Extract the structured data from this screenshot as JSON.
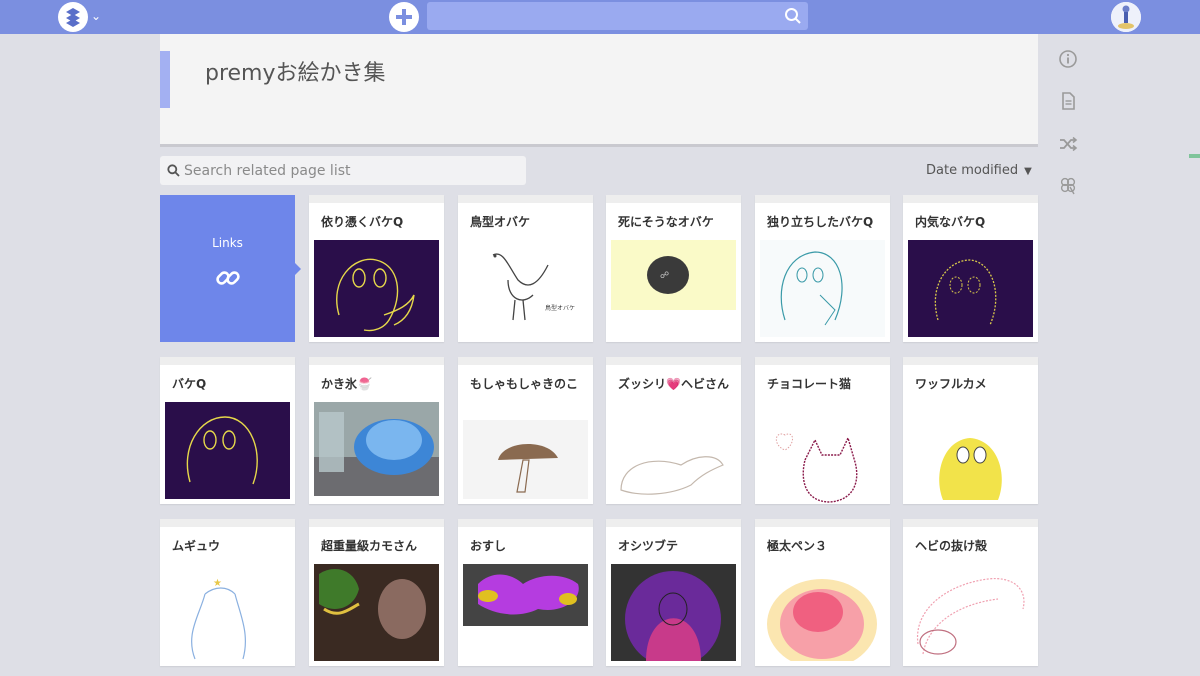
{
  "header": {
    "logo_icon": "scrapbox-logo-icon",
    "menu_caret": "⌄",
    "new_page_icon": "plus-icon",
    "search_icon": "search-icon",
    "search_value": "",
    "accent": "#7b8fe0"
  },
  "page": {
    "title": "premyお絵かき集"
  },
  "side_menu": [
    {
      "icon": "info-icon"
    },
    {
      "icon": "document-icon"
    },
    {
      "icon": "shuffle-icon"
    },
    {
      "icon": "clover-icon"
    }
  ],
  "related": {
    "placeholder": "Search related page list",
    "sort_label": "Date modified",
    "links_label": "Links",
    "links_icon": "link-icon"
  },
  "cards": [
    {
      "title": "依り憑くバケQ"
    },
    {
      "title": "鳥型オバケ"
    },
    {
      "title": "死にそうなオバケ"
    },
    {
      "title": "独り立ちしたバケQ"
    },
    {
      "title": "内気なバケQ"
    },
    {
      "title": "バケQ"
    },
    {
      "title": "かき氷🍧"
    },
    {
      "title": "もしゃもしゃきのこ"
    },
    {
      "title": "ズッシリ💗ヘビさん"
    },
    {
      "title": "チョコレート猫"
    },
    {
      "title": "ワッフルカメ"
    },
    {
      "title": "ムギュウ"
    },
    {
      "title": "超重量級カモさん"
    },
    {
      "title": "おすし"
    },
    {
      "title": "オシツブテ"
    },
    {
      "title": "極太ペン３"
    },
    {
      "title": "ヘビの抜け殻"
    }
  ],
  "thumb_texts": {
    "bird_caption": "鳥型オバケ"
  }
}
